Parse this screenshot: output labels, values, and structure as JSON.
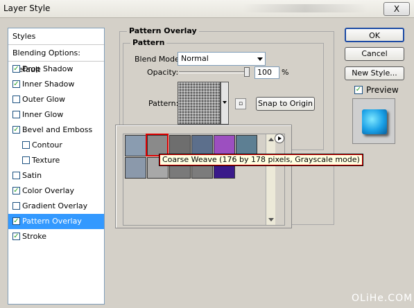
{
  "window": {
    "title": "Layer Style",
    "close_label": "X"
  },
  "styles_panel": {
    "header": "Styles",
    "blending": "Blending Options: Default",
    "items": [
      {
        "label": "Drop Shadow",
        "checked": true
      },
      {
        "label": "Inner Shadow",
        "checked": true
      },
      {
        "label": "Outer Glow",
        "checked": false
      },
      {
        "label": "Inner Glow",
        "checked": false
      },
      {
        "label": "Bevel and Emboss",
        "checked": true
      },
      {
        "label": "Contour",
        "checked": false
      },
      {
        "label": "Texture",
        "checked": false
      },
      {
        "label": "Satin",
        "checked": false
      },
      {
        "label": "Color Overlay",
        "checked": true
      },
      {
        "label": "Gradient Overlay",
        "checked": false
      },
      {
        "label": "Pattern Overlay",
        "checked": true,
        "selected": true
      },
      {
        "label": "Stroke",
        "checked": true
      }
    ],
    "check_mark": "✓"
  },
  "pattern_overlay": {
    "section_title": "Pattern Overlay",
    "group_title": "Pattern",
    "blend_mode_label": "Blend Mode:",
    "blend_mode_value": "Normal",
    "opacity_label": "Opacity:",
    "opacity_value": "100",
    "opacity_unit": "%",
    "opacity_fraction": 1.0,
    "pattern_label": "Pattern:",
    "snap_button": "Snap to Origin"
  },
  "picker": {
    "tooltip": "Coarse Weave (176 by 178 pixels, Grayscale mode)",
    "swatch_colors": [
      "#8a9cb0",
      "#8a8a8a",
      "#6e6e6e",
      "#5c6f8c",
      "#9c4fc0",
      "#5d7f93",
      "#8b99ab",
      "#a8a8a8",
      "#7a7a7a",
      "#7c7c7c",
      "#3a1a8a"
    ],
    "selected_index": 1
  },
  "buttons": {
    "ok": "OK",
    "cancel": "Cancel",
    "new_style": "New Style..."
  },
  "preview": {
    "label": "Preview",
    "checked": true
  },
  "watermark": "OLiHe.COM"
}
